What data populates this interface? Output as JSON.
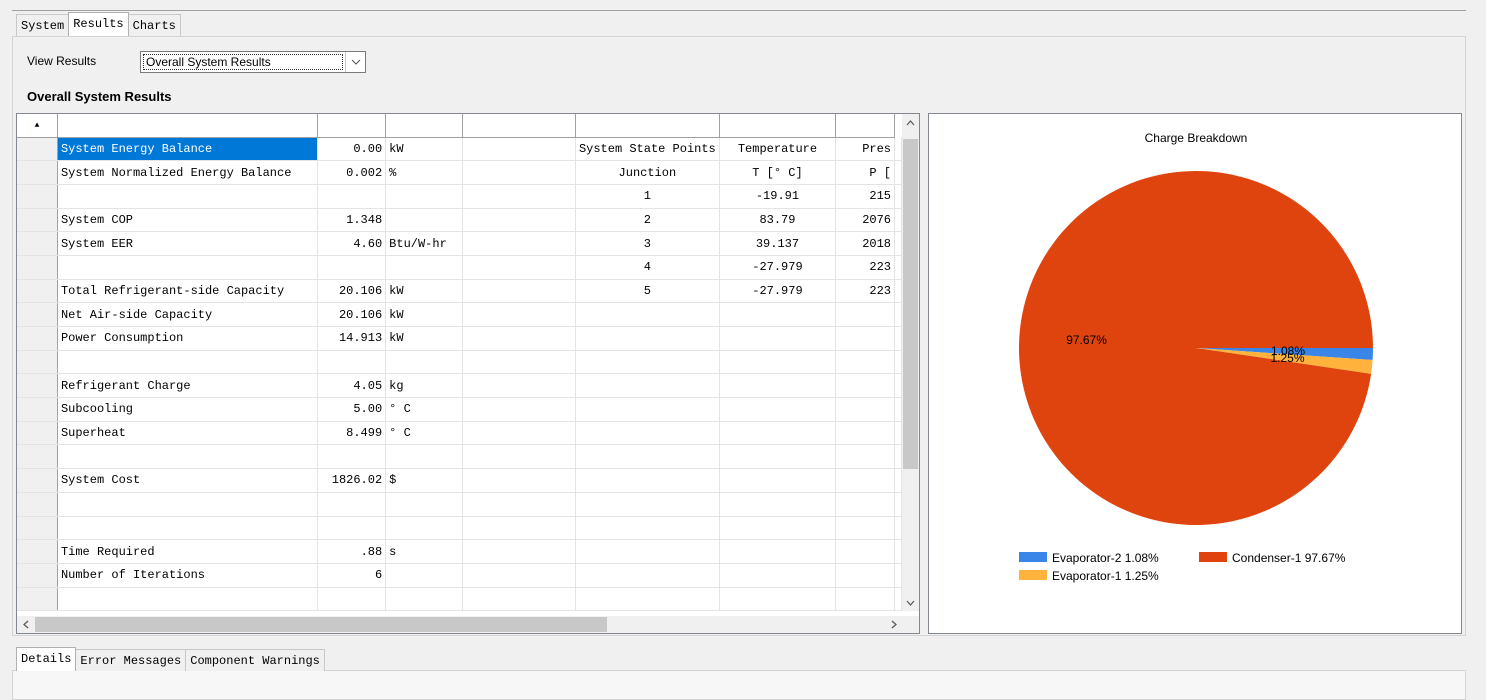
{
  "top_tabs": [
    "System",
    "Results",
    "Charts"
  ],
  "view_results": {
    "label": "View Results",
    "selected": "Overall System Results"
  },
  "section_title": "Overall System Results",
  "grid": {
    "rows": [
      [
        "System Energy Balance",
        "0.00",
        "kW",
        "",
        "System State Points",
        "Temperature",
        "Pres"
      ],
      [
        "System Normalized Energy Balance",
        "0.002",
        "%",
        "",
        "Junction",
        "T [° C]",
        "P ["
      ],
      [
        "",
        "",
        "",
        "",
        "1",
        "-19.91",
        "215"
      ],
      [
        "System COP",
        "1.348",
        "",
        "",
        "2",
        "83.79",
        "2076"
      ],
      [
        "System EER",
        "4.60",
        "Btu/W-hr",
        "",
        "3",
        "39.137",
        "2018"
      ],
      [
        "",
        "",
        "",
        "",
        "4",
        "-27.979",
        "223"
      ],
      [
        "Total Refrigerant-side Capacity",
        "20.106",
        "kW",
        "",
        "5",
        "-27.979",
        "223"
      ],
      [
        "Net Air-side Capacity",
        "20.106",
        "kW",
        "",
        "",
        "",
        ""
      ],
      [
        "Power Consumption",
        "14.913",
        "kW",
        "",
        "",
        "",
        ""
      ],
      [
        "",
        "",
        "",
        "",
        "",
        "",
        ""
      ],
      [
        "Refrigerant Charge",
        "4.05",
        "kg",
        "",
        "",
        "",
        ""
      ],
      [
        "Subcooling",
        "5.00",
        "° C",
        "",
        "",
        "",
        ""
      ],
      [
        "Superheat",
        "8.499",
        "° C",
        "",
        "",
        "",
        ""
      ],
      [
        "",
        "",
        "",
        "",
        "",
        "",
        ""
      ],
      [
        "System Cost",
        "1826.02",
        "$",
        "",
        "",
        "",
        ""
      ],
      [
        "",
        "",
        "",
        "",
        "",
        "",
        ""
      ],
      [
        "",
        "",
        "",
        "",
        "",
        "",
        ""
      ],
      [
        "Time Required",
        ".88",
        "s",
        "",
        "",
        "",
        ""
      ],
      [
        "Number of Iterations",
        "6",
        "",
        "",
        "",
        "",
        ""
      ],
      [
        "",
        "",
        "",
        "",
        "",
        "",
        ""
      ]
    ]
  },
  "chart_data": {
    "type": "pie",
    "title": "Charge Breakdown",
    "slices": [
      {
        "name": "Evaporator-2",
        "value": 1.08,
        "label": "1.08%",
        "legend": "Evaporator-2  1.08%",
        "color": "#3a86e8"
      },
      {
        "name": "Evaporator-1",
        "value": 1.25,
        "label": "1.25%",
        "legend": "Evaporator-1  1.25%",
        "color": "#ffb23c"
      },
      {
        "name": "Condenser-1",
        "value": 97.67,
        "label": "97.67%",
        "legend": "Condenser-1  97.67%",
        "color": "#e0440e"
      }
    ],
    "legend_placement": "bottom"
  },
  "bottom_tabs": [
    "Details",
    "Error Messages",
    "Component Warnings"
  ]
}
